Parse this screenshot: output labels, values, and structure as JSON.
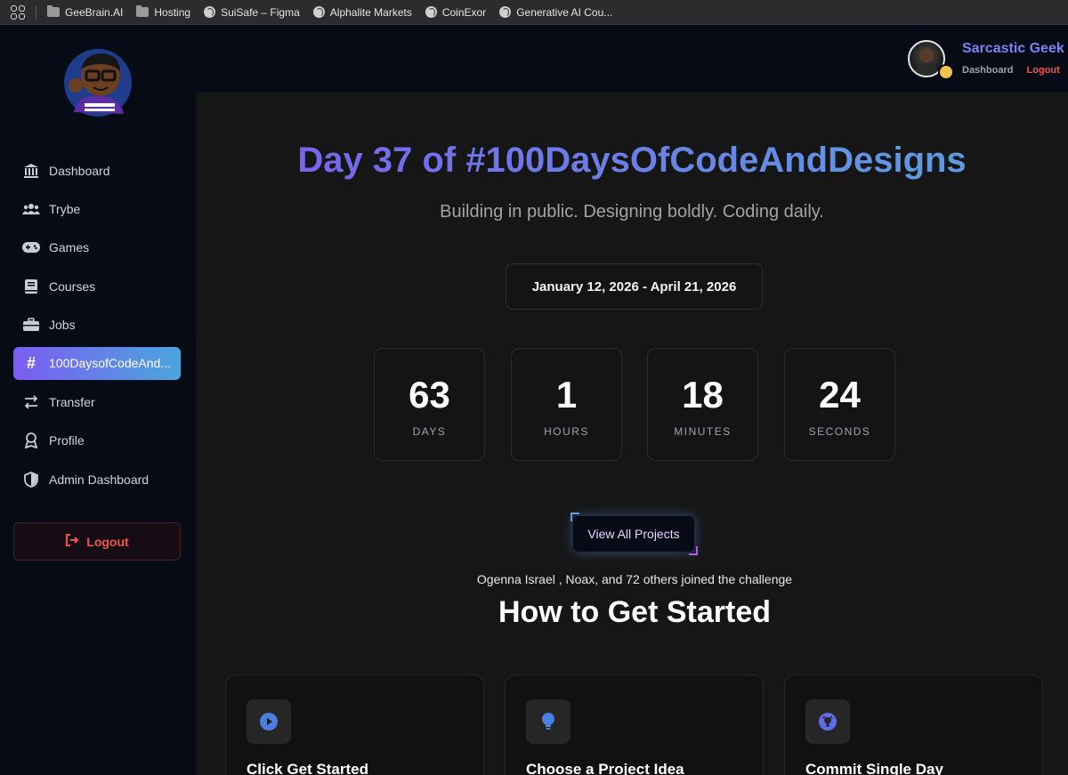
{
  "bookmarks": {
    "items": [
      {
        "label": "GeeBrain.AI",
        "icon": "folder-icon"
      },
      {
        "label": "Hosting",
        "icon": "folder-icon"
      },
      {
        "label": "SuiSafe – Figma",
        "icon": "globe-icon"
      },
      {
        "label": "Alphalite Markets",
        "icon": "globe-icon"
      },
      {
        "label": "CoinExor",
        "icon": "globe-icon"
      },
      {
        "label": "Generative AI Cou...",
        "icon": "globe-icon"
      }
    ]
  },
  "sidebar": {
    "items": [
      {
        "label": "Dashboard",
        "icon": "bank-icon"
      },
      {
        "label": "Trybe",
        "icon": "users-icon"
      },
      {
        "label": "Games",
        "icon": "gamepad-icon"
      },
      {
        "label": "Courses",
        "icon": "book-icon"
      },
      {
        "label": "Jobs",
        "icon": "briefcase-icon"
      },
      {
        "label": "100DaysofCodeAnd...",
        "icon": "hashtag-icon",
        "active": true
      },
      {
        "label": "Transfer",
        "icon": "transfer-icon"
      },
      {
        "label": "Profile",
        "icon": "award-icon"
      },
      {
        "label": "Admin Dashboard",
        "icon": "shield-icon"
      }
    ],
    "logout_label": "Logout"
  },
  "header": {
    "user_name": "Sarcastic Geek",
    "dashboard_link": "Dashboard",
    "logout_link": "Logout"
  },
  "hero": {
    "title": "Day 37 of #100DaysOfCodeAndDesigns",
    "subtitle": "Building in public. Designing boldly. Coding daily.",
    "date_range": "January 12, 2026 - April 21, 2026"
  },
  "countdown": [
    {
      "value": "63",
      "label": "DAYS"
    },
    {
      "value": "1",
      "label": "HOURS"
    },
    {
      "value": "18",
      "label": "MINUTES"
    },
    {
      "value": "24",
      "label": "SECONDS"
    }
  ],
  "projects_button": "View All Projects",
  "joined_text": "Ogenna Israel , Noax, and 72 others joined the challenge",
  "how_to": {
    "title": "How to Get Started",
    "steps": [
      {
        "title": "Click Get Started",
        "icon": "play-icon"
      },
      {
        "title": "Choose a Project Idea",
        "icon": "lightbulb-icon"
      },
      {
        "title": "Commit Single Day",
        "icon": "github-icon"
      }
    ]
  },
  "colors": {
    "accent_start": "#7b5cf1",
    "accent_end": "#5aa4de",
    "danger": "#ef5350"
  }
}
